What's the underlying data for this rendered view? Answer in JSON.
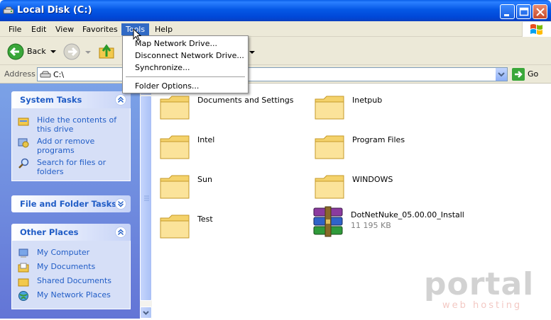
{
  "window": {
    "title": "Local Disk (C:)"
  },
  "menubar": {
    "items": [
      "File",
      "Edit",
      "View",
      "Favorites",
      "Tools",
      "Help"
    ],
    "active": "Tools"
  },
  "toolbar": {
    "back_label": "Back"
  },
  "address": {
    "label": "Address",
    "value": "C:\\",
    "go_label": "Go"
  },
  "tools_menu": {
    "items": [
      "Map Network Drive...",
      "Disconnect Network Drive...",
      "Synchronize...",
      "Folder Options..."
    ]
  },
  "task_pane": {
    "system_tasks": {
      "title": "System Tasks",
      "items": [
        "Hide the contents of this drive",
        "Add or remove programs",
        "Search for files or folders"
      ]
    },
    "file_folder_tasks": {
      "title": "File and Folder Tasks"
    },
    "other_places": {
      "title": "Other Places",
      "items": [
        "My Computer",
        "My Documents",
        "Shared Documents",
        "My Network Places"
      ]
    }
  },
  "files": [
    {
      "name": "Documents and Settings",
      "type": "folder"
    },
    {
      "name": "Inetpub",
      "type": "folder"
    },
    {
      "name": "Intel",
      "type": "folder"
    },
    {
      "name": "Program Files",
      "type": "folder"
    },
    {
      "name": "Sun",
      "type": "folder"
    },
    {
      "name": "WINDOWS",
      "type": "folder"
    },
    {
      "name": "Test",
      "type": "folder"
    },
    {
      "name": "DotNetNuke_05.00.00_Install",
      "type": "archive",
      "size": "11 195 KB"
    }
  ],
  "watermark": {
    "brand": "portal",
    "tagline": "web hosting"
  },
  "colors": {
    "title_bar": "#0558e6",
    "task_pane": "#7ba2e7",
    "link": "#215dc6",
    "menu_highlight": "#316ac5"
  }
}
